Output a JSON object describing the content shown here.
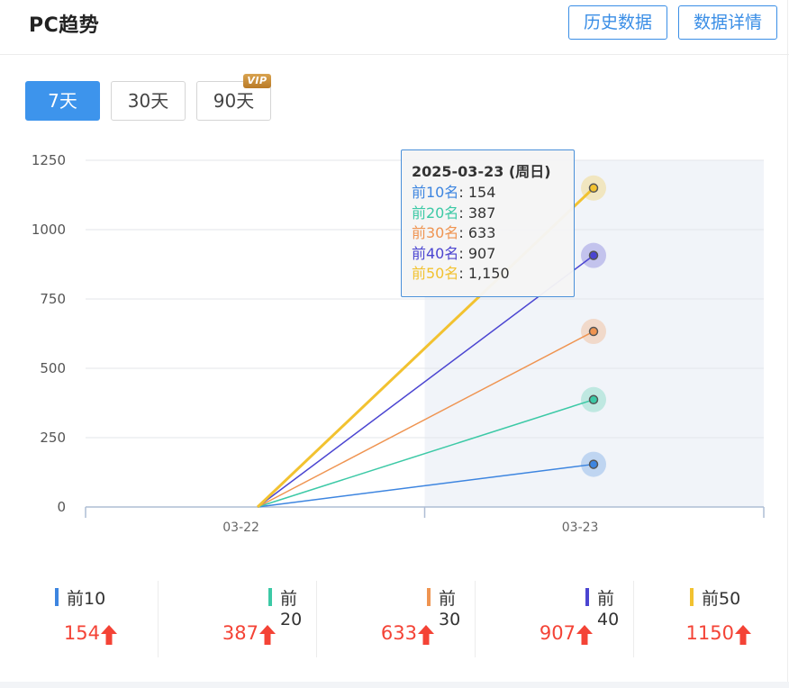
{
  "header": {
    "title": "PC趋势",
    "history_label": "历史数据",
    "detail_label": "数据详情"
  },
  "range": {
    "buttons": [
      "7天",
      "30天",
      "90天"
    ],
    "active": "7天",
    "vip_badge": "VIP"
  },
  "colors": {
    "accent": "#3d94ec",
    "up": "#f44336"
  },
  "chart_data": {
    "type": "line",
    "categories": [
      "03-22",
      "03-23"
    ],
    "ylim": [
      0,
      1250
    ],
    "yticks": [
      "0",
      "250",
      "500",
      "750",
      "1000",
      "1250"
    ],
    "series": [
      {
        "name": "前10名",
        "color": "#3d85e0",
        "values": [
          0,
          154
        ]
      },
      {
        "name": "前20名",
        "color": "#3cc9a6",
        "values": [
          0,
          387
        ]
      },
      {
        "name": "前30名",
        "color": "#ef9451",
        "values": [
          0,
          633
        ]
      },
      {
        "name": "前40名",
        "color": "#4b45d1",
        "values": [
          0,
          907
        ]
      },
      {
        "name": "前50名",
        "color": "#f2c230",
        "values": [
          0,
          1150
        ]
      }
    ],
    "highlight_category": "03-23"
  },
  "tooltip": {
    "title": "2025-03-23 (周日)",
    "rows": [
      {
        "label": "前10名",
        "sep": ": ",
        "value": "154",
        "color": "#3d85e0"
      },
      {
        "label": "前20名",
        "sep": ": ",
        "value": "387",
        "color": "#3cc9a6"
      },
      {
        "label": "前30名",
        "sep": ": ",
        "value": "633",
        "color": "#ef9451"
      },
      {
        "label": "前40名",
        "sep": ": ",
        "value": "907",
        "color": "#4b45d1"
      },
      {
        "label": "前50名",
        "sep": ": ",
        "value": "1,150",
        "color": "#f2c230"
      }
    ]
  },
  "summary": [
    {
      "label": "前10",
      "value": "154",
      "color": "#3d85e0"
    },
    {
      "label": "前20",
      "value": "387",
      "color": "#3cc9a6"
    },
    {
      "label": "前30",
      "value": "633",
      "color": "#ef9451"
    },
    {
      "label": "前40",
      "value": "907",
      "color": "#4b45d1"
    },
    {
      "label": "前50",
      "value": "1150",
      "color": "#f2c230"
    }
  ]
}
